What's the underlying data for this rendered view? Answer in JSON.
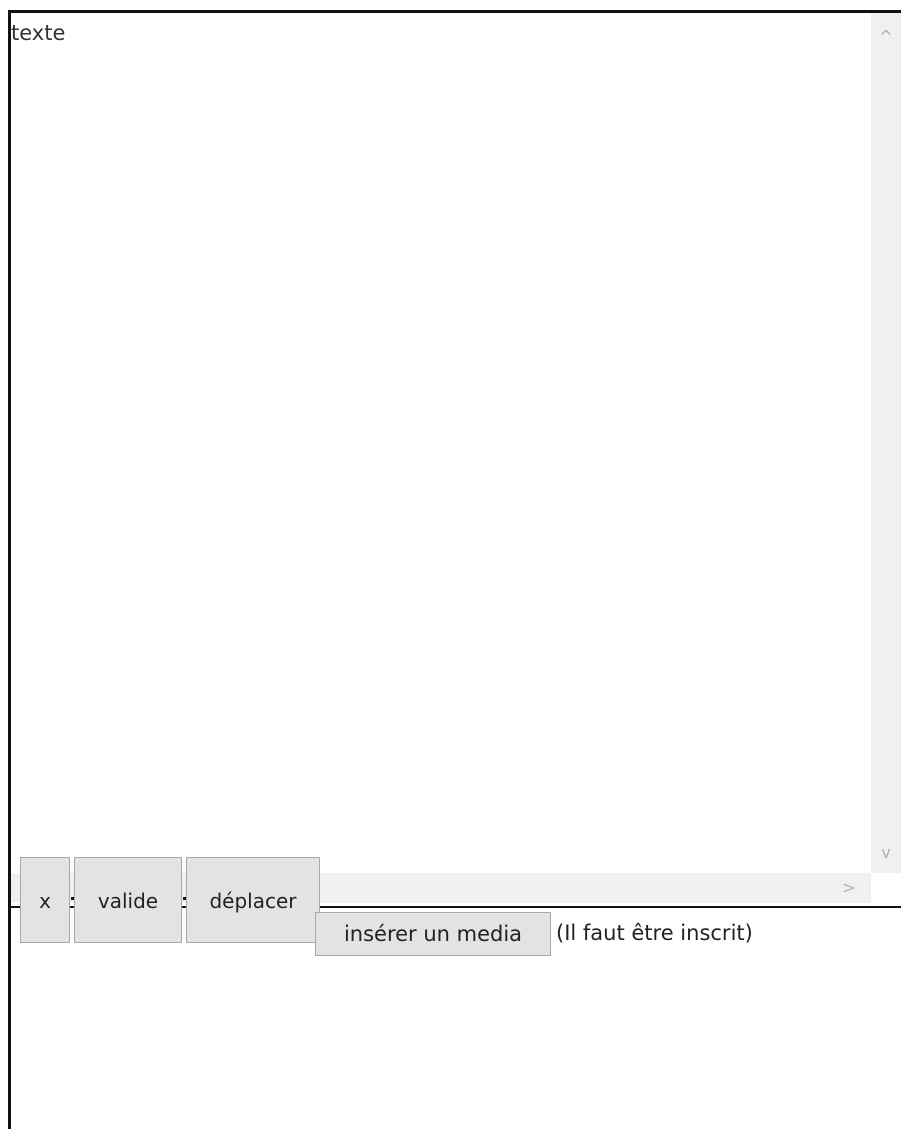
{
  "editor": {
    "content": "texte"
  },
  "scrollbars": {
    "up_arrow": "^",
    "down_arrow": "v",
    "right_arrow": ">"
  },
  "toolbar": {
    "close_label": "x",
    "validate_label": "valide",
    "move_label": "déplacer"
  },
  "media": {
    "insert_label": "insérer un media",
    "note": "(Il faut être inscrit)"
  }
}
